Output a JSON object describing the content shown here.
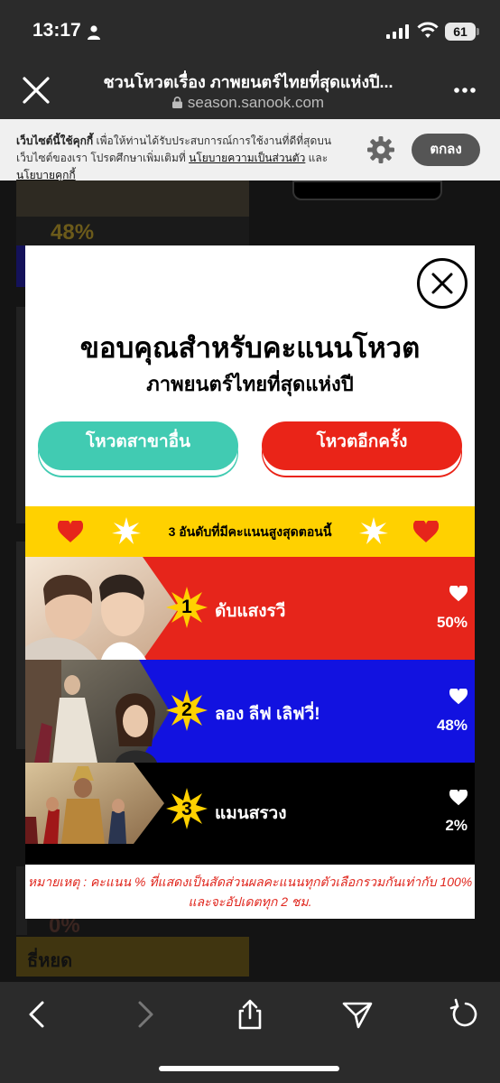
{
  "status_bar": {
    "time": "13:17",
    "battery": "61"
  },
  "browser": {
    "page_title": "ชวนโหวตเรื่อง ภาพยนตร์ไทยที่สุดแห่งปี...",
    "url": "season.sanook.com"
  },
  "cookie_banner": {
    "lead": "เว็บไซต์นี้ใช้คุกกี้",
    "text": " เพื่อให้ท่านได้รับประสบการณ์การใช้งานที่ดีที่สุดบน เว็บไซต์ของเรา โปรดศึกษาเพิ่มเติมที่ ",
    "privacy_link": "นโยบายความเป็นส่วนตัว",
    "and": " และ ",
    "cookie_link": "นโยบายคุกกี้",
    "accept_label": "ตกลง"
  },
  "background": {
    "percent_top": "48%",
    "percent_bottom": "0%",
    "label_bottom": "ธี่หยด"
  },
  "modal": {
    "title": "ขอบคุณสำหรับคะแนนโหวต",
    "subtitle": "ภาพยนตร์ไทยที่สุดแห่งปี",
    "vote_other_label": "โหวตสาขาอื่น",
    "vote_again_label": "โหวตอีกครั้ง",
    "top3_heading": "3 อันดับที่มีคะแนนสูงสุดตอนนี้",
    "ranks": [
      {
        "rank": "1",
        "title": "ดับแสงรวี",
        "percent": "50%",
        "bg_color": "#e6251b"
      },
      {
        "rank": "2",
        "title": "ลอง ลีฟ เลิฟวี่!",
        "percent": "48%",
        "bg_color": "#1212e0"
      },
      {
        "rank": "3",
        "title": "แมนสรวง",
        "percent": "2%",
        "bg_color": "#000000"
      }
    ],
    "note": "หมายเหตุ : คะแนน % ที่แสดงเป็นสัดส่วนผลคะแนนทุกตัวเลือกรวมกันเท่ากับ 100% และจะอัปเดตทุก 2 ชม."
  },
  "colors": {
    "yellow": "#ffd100",
    "red": "#e6251b",
    "blue": "#1212e0",
    "teal": "#41cbb2"
  }
}
